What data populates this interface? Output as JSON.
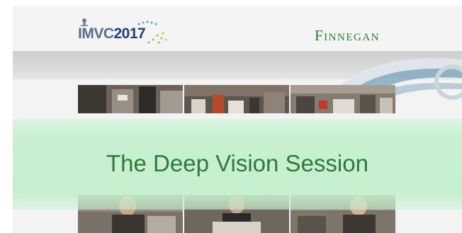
{
  "logo": {
    "main": "IMVC",
    "year": "2017"
  },
  "brand": {
    "name": "Finnegan"
  },
  "session": {
    "title": "The Deep Vision Session"
  },
  "colors": {
    "brand_green": "#2c7a36",
    "banner_green": "#c2efcc",
    "logo_blue": "#1f3f86"
  },
  "photos": [
    {
      "name": "conference-crowd-photo"
    },
    {
      "name": "conference-table-photo"
    },
    {
      "name": "conference-booth-photo"
    },
    {
      "name": "speaker-left-photo"
    },
    {
      "name": "speaker-center-photo"
    },
    {
      "name": "speaker-right-photo"
    }
  ]
}
